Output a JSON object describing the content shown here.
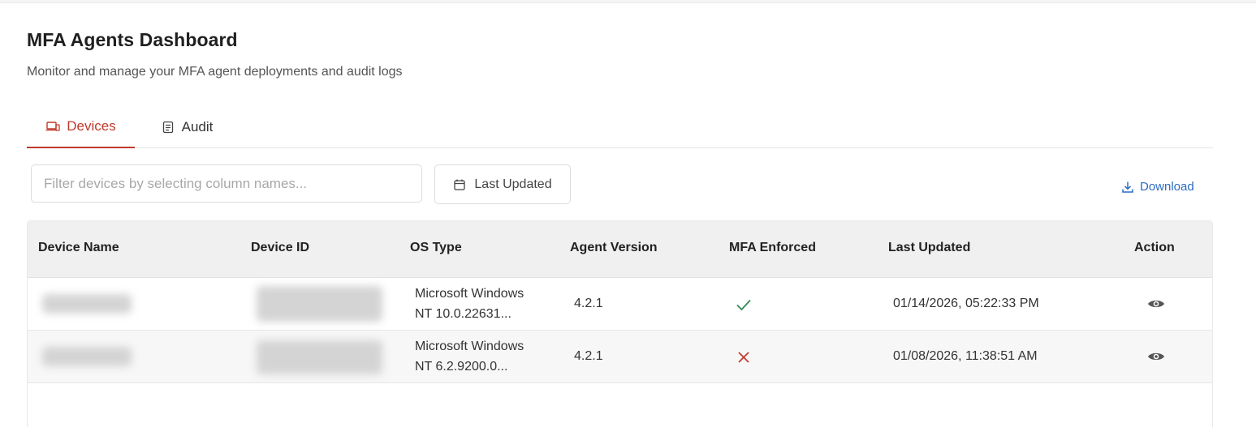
{
  "page": {
    "title": "MFA Agents Dashboard",
    "subtitle": "Monitor and manage your MFA agent deployments and audit logs"
  },
  "tabs": [
    {
      "label": "Devices",
      "icon": "laptop-icon",
      "active": true
    },
    {
      "label": "Audit",
      "icon": "document-icon",
      "active": false
    }
  ],
  "toolbar": {
    "filter_placeholder": "Filter devices by selecting column names...",
    "date_filter_label": "Last Updated",
    "download_label": "Download"
  },
  "table": {
    "columns": [
      "Device Name",
      "Device ID",
      "OS Type",
      "Agent Version",
      "MFA Enforced",
      "Last Updated",
      "Action"
    ],
    "rows": [
      {
        "device_name": "",
        "device_id": "",
        "os_line1": "Microsoft Windows",
        "os_line2": "NT 10.0.22631...",
        "agent_version": "4.2.1",
        "mfa_enforced": true,
        "last_updated": "01/14/2026, 05:22:33 PM",
        "action_icon": "eye-icon"
      },
      {
        "device_name": "",
        "device_id": "",
        "os_line1": "Microsoft Windows",
        "os_line2": "NT 6.2.9200.0...",
        "agent_version": "4.2.1",
        "mfa_enforced": false,
        "last_updated": "01/08/2026, 11:38:51 AM",
        "action_icon": "eye-icon"
      }
    ]
  },
  "colors": {
    "accent": "#c0392b",
    "link": "#2d6cc0",
    "check": "#2e8b57",
    "cross": "#c0392b"
  }
}
